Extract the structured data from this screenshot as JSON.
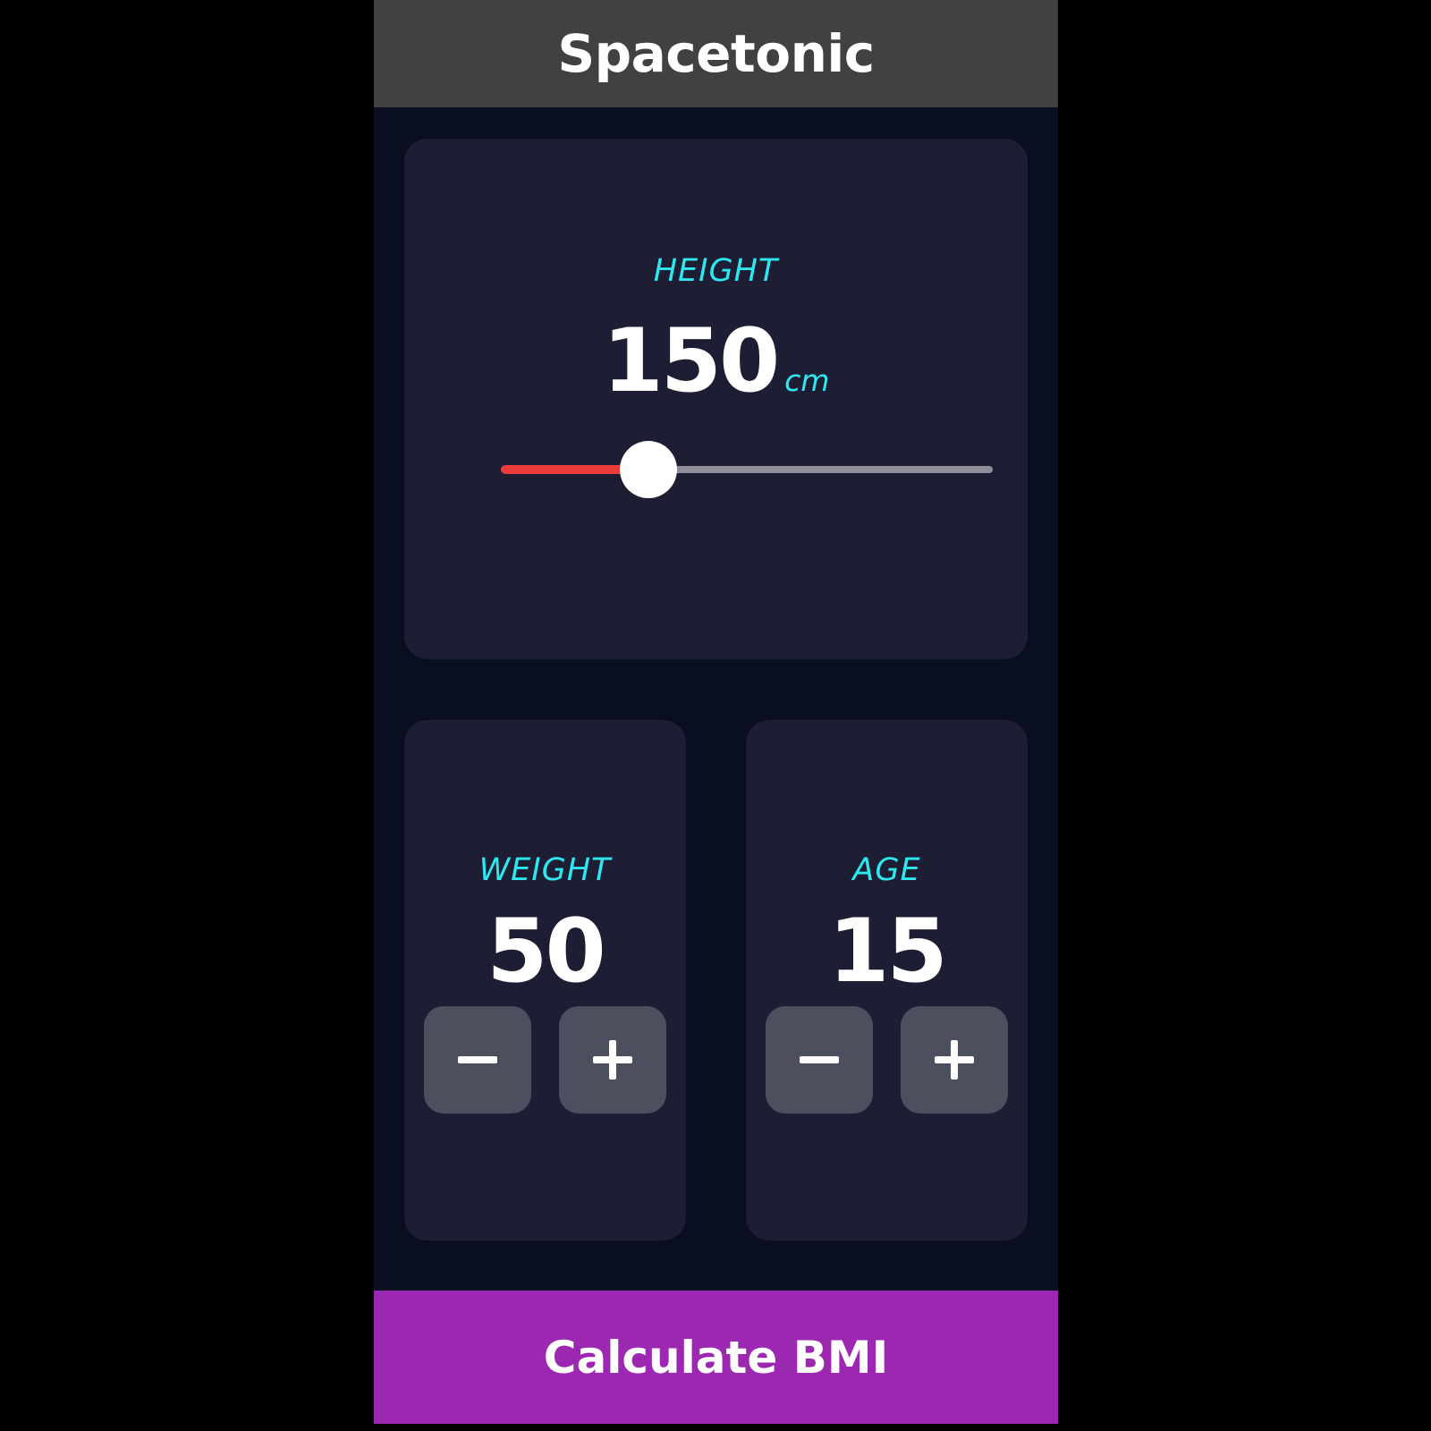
{
  "appbar": {
    "title": "Spacetonic"
  },
  "colors": {
    "accent": "#2ee8f0",
    "slider_active": "#eb3b3b",
    "cta": "#9c27b0",
    "card": "#1d1e33",
    "background": "#0a0e21"
  },
  "height": {
    "label": "HEIGHT",
    "value": "150",
    "unit": "cm",
    "slider_fraction": 0.3
  },
  "weight": {
    "label": "WEIGHT",
    "value": "50",
    "minus_icon": "minus-icon",
    "plus_icon": "plus-icon"
  },
  "age": {
    "label": "AGE",
    "value": "15",
    "minus_icon": "minus-icon",
    "plus_icon": "plus-icon"
  },
  "cta": {
    "label": "Calculate BMI"
  }
}
